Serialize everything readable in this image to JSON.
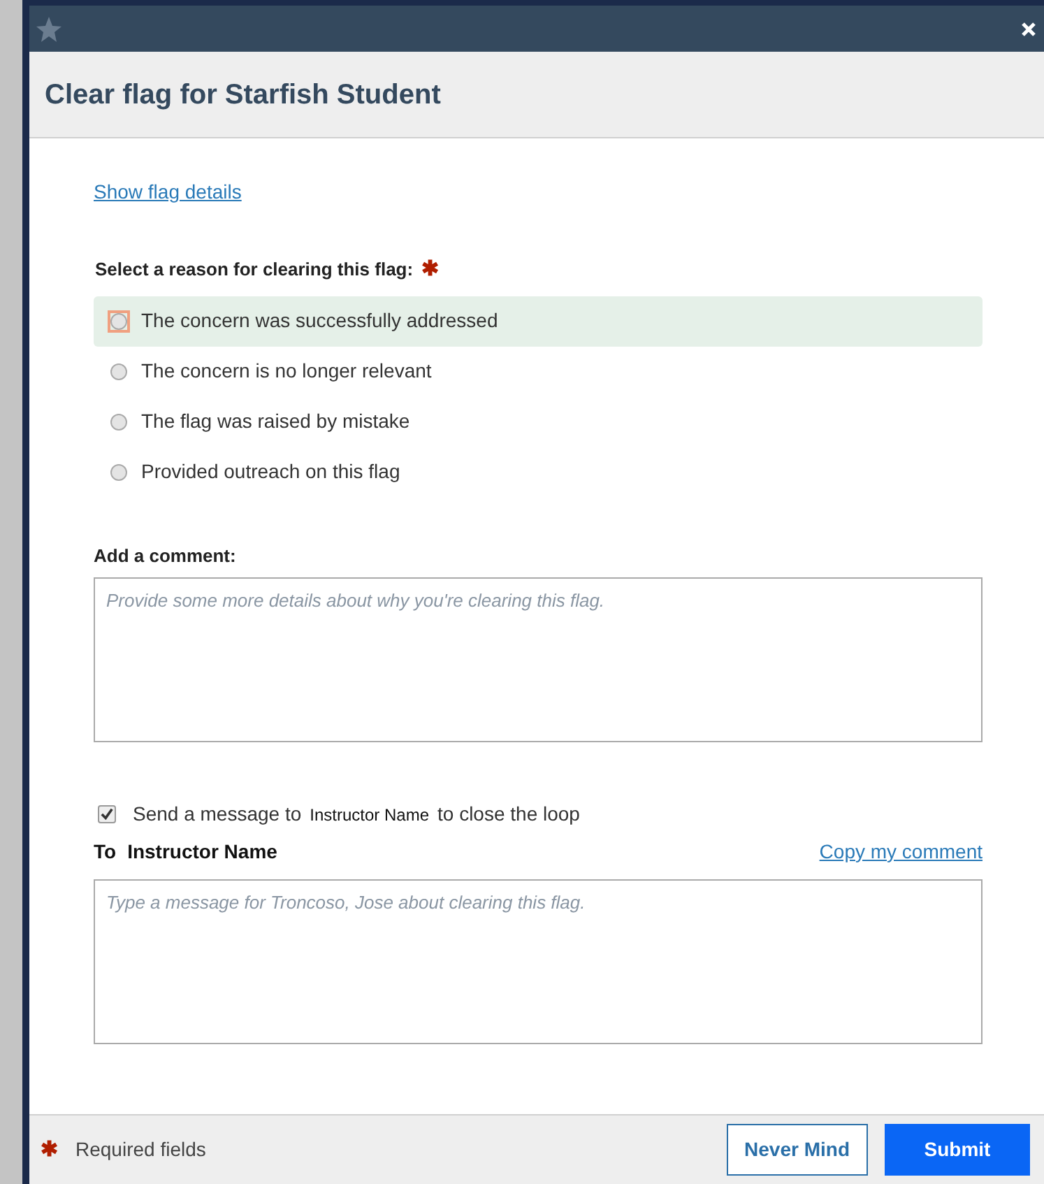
{
  "dialog": {
    "title": "Clear flag for Starfish Student"
  },
  "show_details_link": "Show flag details",
  "reason": {
    "label": "Select a reason for clearing this flag:",
    "required_mark": "✱",
    "options": [
      {
        "label": "The concern was successfully addressed",
        "selected": false,
        "focused": true
      },
      {
        "label": "The concern is no longer relevant",
        "selected": false,
        "focused": false
      },
      {
        "label": "The flag was raised by mistake",
        "selected": false,
        "focused": false
      },
      {
        "label": "Provided outreach on this flag",
        "selected": false,
        "focused": false
      }
    ]
  },
  "comment": {
    "label": "Add a comment:",
    "placeholder": "Provide some more details about why you're clearing this flag."
  },
  "send_message": {
    "checked": true,
    "text_before": "Send a message to",
    "recipient": "Instructor Name",
    "text_after": "to close the loop"
  },
  "message": {
    "to_label": "To",
    "recipient": "Instructor Name",
    "copy_link": "Copy my comment",
    "placeholder": "Type a message for Troncoso, Jose about clearing this flag."
  },
  "footer": {
    "required_mark": "✱",
    "required_note": "Required fields",
    "buttons": [
      {
        "label": "Never Mind",
        "kind": "secondary"
      },
      {
        "label": "Submit",
        "kind": "primary"
      }
    ]
  }
}
